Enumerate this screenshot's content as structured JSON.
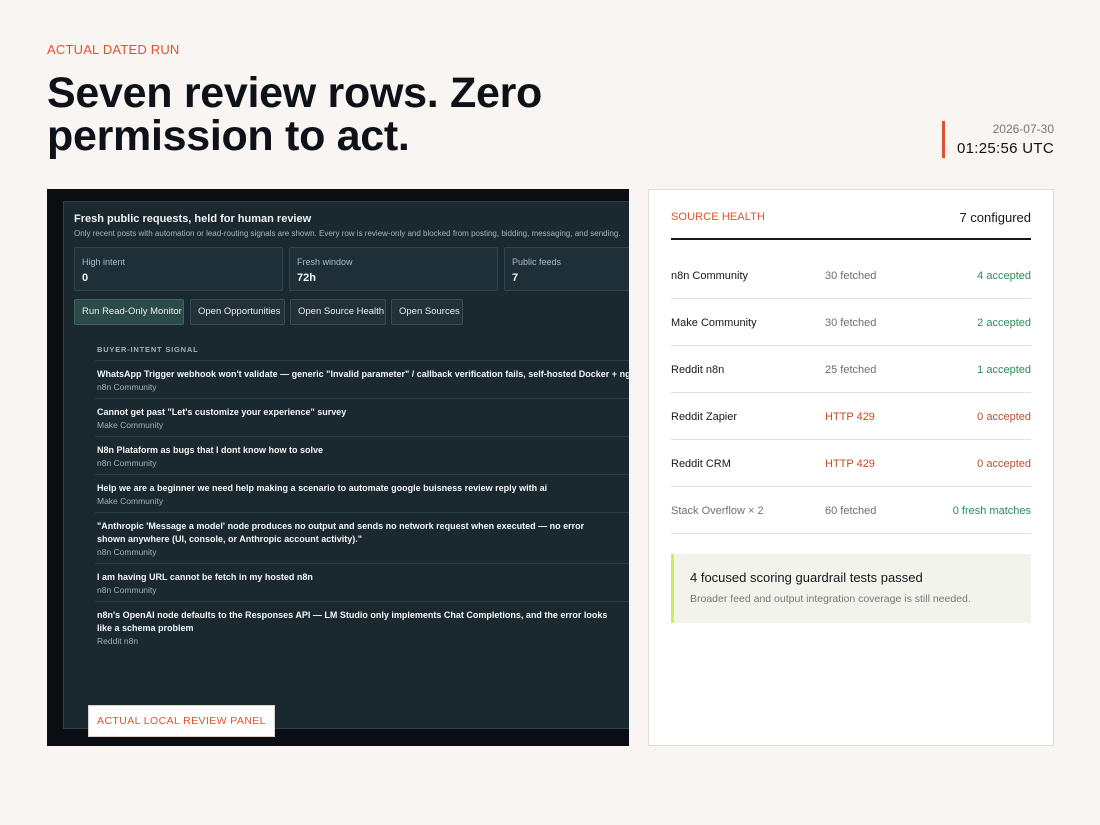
{
  "header": {
    "eyebrow": "ACTUAL DATED RUN",
    "headline": "Seven review rows. Zero permission to act.",
    "run_date": "2026-07-30",
    "run_time": "01:25:56 UTC"
  },
  "screenshot": {
    "title": "Fresh public requests, held for human review",
    "subtitle": "Only recent posts with automation or lead-routing signals are shown. Every row is review-only and blocked from posting, bidding, messaging, and sending.",
    "metrics": [
      {
        "label": "High intent",
        "value": "0"
      },
      {
        "label": "Fresh window",
        "value": "72h"
      },
      {
        "label": "Public feeds",
        "value": "7"
      }
    ],
    "buttons": [
      "Run Read-Only Monitor",
      "Open Opportunities",
      "Open Source Health",
      "Open Sources"
    ],
    "signal_heading": "BUYER-INTENT SIGNAL",
    "rows": [
      {
        "title": "WhatsApp Trigger webhook won't validate — generic \"Invalid parameter\" / callback verification fails, self-hosted Docker + ngrok",
        "source": "n8n Community"
      },
      {
        "title": "Cannot get past \"Let's customize your experience\" survey",
        "source": "Make Community"
      },
      {
        "title": "N8n Plataform as bugs that I dont know how to solve",
        "source": "n8n Community"
      },
      {
        "title": "Help we are a beginner we need help making a scenario to automate google buisness review reply with ai",
        "source": "Make Community"
      },
      {
        "title": "\"Anthropic 'Message a model' node produces no output and sends no network request when executed — no error shown anywhere (UI, console, or Anthropic account activity).\"",
        "source": "n8n Community"
      },
      {
        "title": "I am having URL cannot be fetch in my hosted n8n",
        "source": "n8n Community"
      },
      {
        "title": "n8n's OpenAI node defaults to the Responses API — LM Studio only implements Chat Completions, and the error looks like a schema problem",
        "source": "Reddit n8n"
      }
    ],
    "tag": "ACTUAL LOCAL REVIEW PANEL"
  },
  "source_health": {
    "label": "SOURCE HEALTH",
    "count": "7 configured",
    "rows": [
      {
        "name": "n8n Community",
        "fetched": "30 fetched",
        "accepted": "4 accepted",
        "status": "ok"
      },
      {
        "name": "Make Community",
        "fetched": "30 fetched",
        "accepted": "2 accepted",
        "status": "ok"
      },
      {
        "name": "Reddit n8n",
        "fetched": "25 fetched",
        "accepted": "1 accepted",
        "status": "ok"
      },
      {
        "name": "Reddit Zapier",
        "fetched": "HTTP 429",
        "accepted": "0 accepted",
        "status": "error"
      },
      {
        "name": "Reddit CRM",
        "fetched": "HTTP 429",
        "accepted": "0 accepted",
        "status": "error"
      },
      {
        "name": "Stack Overflow × 2",
        "fetched": "60 fetched",
        "accepted": "0 fresh matches",
        "status": "muted"
      }
    ],
    "guardrail": {
      "title": "4 focused scoring guardrail tests passed",
      "subtitle": "Broader feed and output integration coverage is still needed."
    }
  },
  "colors": {
    "accent": "#e0522f",
    "success": "#2f8a5a",
    "guard_bar": "#c8ee5c",
    "panel_bg": "#1a2830"
  }
}
